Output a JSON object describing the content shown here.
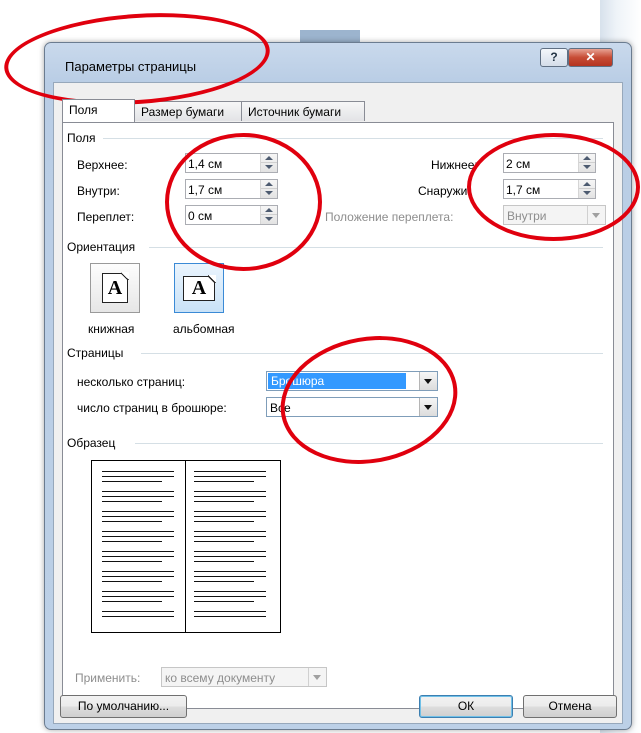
{
  "window": {
    "title": "Параметры страницы",
    "help_glyph": "?",
    "close_glyph": "✕"
  },
  "tabs": [
    {
      "label": "Поля",
      "active": true
    },
    {
      "label": "Размер бумаги",
      "active": false
    },
    {
      "label": "Источник бумаги",
      "active": false
    }
  ],
  "margins": {
    "group_title": "Поля",
    "top_label": "Верхнее:",
    "top_value": "1,4 см",
    "bottom_label": "Нижнее:",
    "bottom_value": "2 см",
    "inside_label": "Внутри:",
    "inside_value": "1,7 см",
    "outside_label": "Снаружи:",
    "outside_value": "1,7 см",
    "gutter_label": "Переплет:",
    "gutter_value": "0 см",
    "gutter_pos_label": "Положение переплета:",
    "gutter_pos_value": "Внутри"
  },
  "orientation": {
    "group_title": "Ориентация",
    "portrait_label": "книжная",
    "landscape_label": "альбомная",
    "selected": "landscape",
    "icon_letter": "A"
  },
  "pages": {
    "group_title": "Страницы",
    "multiple_label": "несколько страниц:",
    "multiple_value": "Брошюра",
    "booklet_label": "число страниц в брошюре:",
    "booklet_value": "Все"
  },
  "preview": {
    "group_title": "Образец"
  },
  "apply": {
    "label": "Применить:",
    "value": "ко всему документу"
  },
  "buttons": {
    "default_label": "По умолчанию...",
    "ok_label": "ОК",
    "cancel_label": "Отмена"
  },
  "annotation_color": "#e0000e"
}
